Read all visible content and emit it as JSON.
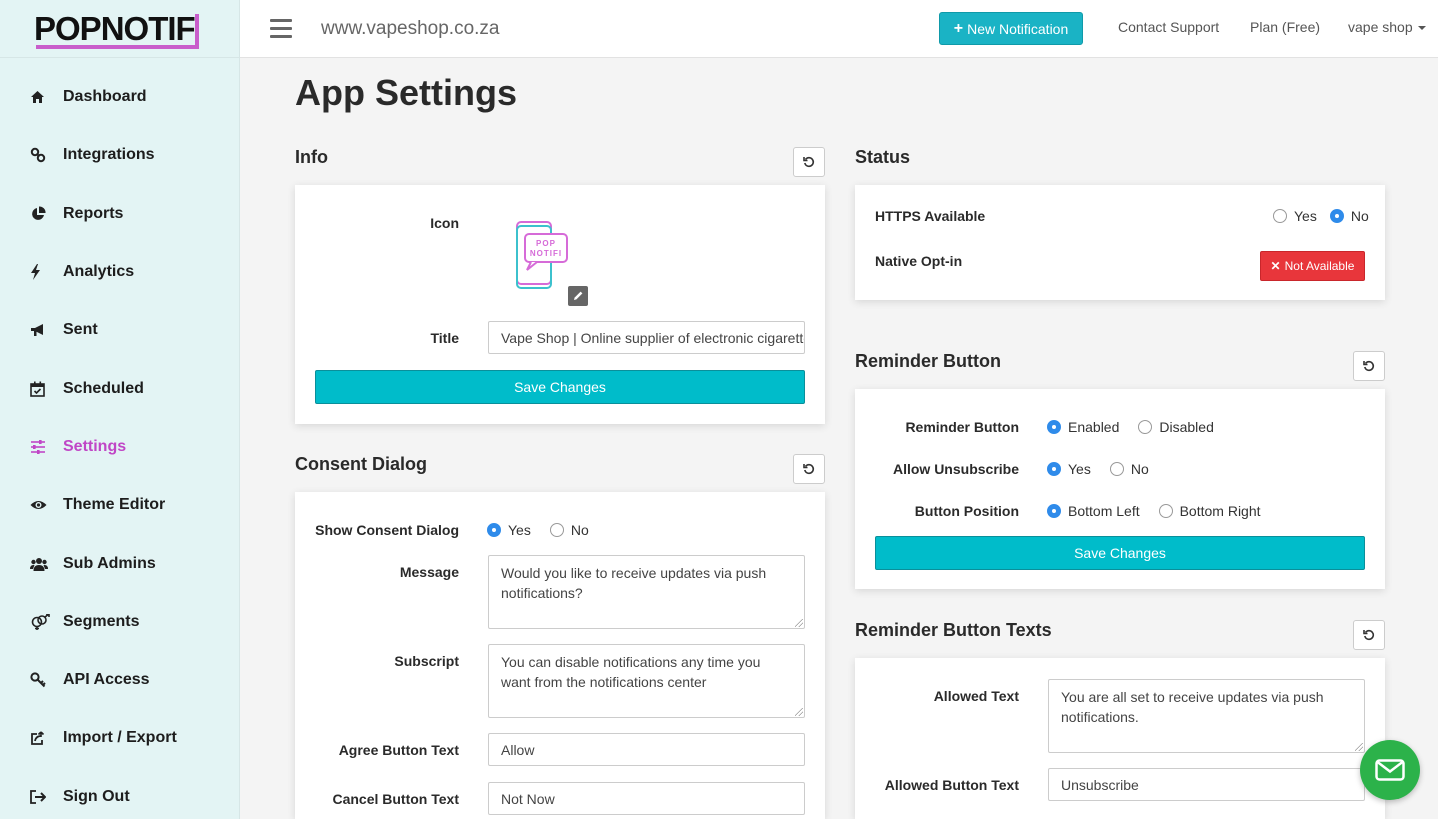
{
  "app": {
    "logo_text": "POPNOTIF"
  },
  "sidebar": {
    "items": [
      {
        "label": "Dashboard",
        "icon": "home-icon"
      },
      {
        "label": "Integrations",
        "icon": "link-icon"
      },
      {
        "label": "Reports",
        "icon": "pie-chart-icon"
      },
      {
        "label": "Analytics",
        "icon": "bolt-icon"
      },
      {
        "label": "Sent",
        "icon": "megaphone-icon"
      },
      {
        "label": "Scheduled",
        "icon": "calendar-check-icon"
      },
      {
        "label": "Settings",
        "icon": "sliders-icon"
      },
      {
        "label": "Theme Editor",
        "icon": "eye-icon"
      },
      {
        "label": "Sub Admins",
        "icon": "users-icon"
      },
      {
        "label": "Segments",
        "icon": "gender-icon"
      },
      {
        "label": "API Access",
        "icon": "key-icon"
      },
      {
        "label": "Import / Export",
        "icon": "share-icon"
      },
      {
        "label": "Sign Out",
        "icon": "sign-out-icon"
      }
    ],
    "active": "Settings"
  },
  "header": {
    "site_url": "www.vapeshop.co.za",
    "new_notification": "New Notification",
    "contact_support": "Contact Support",
    "plan": "Plan (Free)",
    "account": "vape shop"
  },
  "page": {
    "title": "App Settings"
  },
  "info": {
    "title": "Info",
    "icon_label": "Icon",
    "icon_text_top": "POP",
    "icon_text_bottom": "NOTIFI",
    "title_label": "Title",
    "title_value": "Vape Shop | Online supplier of electronic cigarettes",
    "save_label": "Save Changes"
  },
  "consent": {
    "title": "Consent Dialog",
    "show_label": "Show Consent Dialog",
    "show_yes": "Yes",
    "show_no": "No",
    "show_value": "Yes",
    "message_label": "Message",
    "message_value": "Would you like to receive updates via push notifications?",
    "subscript_label": "Subscript",
    "subscript_value": "You can disable notifications any time you want from the notifications center",
    "agree_label": "Agree Button Text",
    "agree_value": "Allow",
    "cancel_label": "Cancel Button Text",
    "cancel_value": "Not Now"
  },
  "status": {
    "title": "Status",
    "https_label": "HTTPS Available",
    "https_yes": "Yes",
    "https_no": "No",
    "https_value": "No",
    "native_label": "Native Opt-in",
    "native_badge": "Not Available"
  },
  "reminder": {
    "title": "Reminder Button",
    "button_label": "Reminder Button",
    "enabled": "Enabled",
    "disabled": "Disabled",
    "button_value": "Enabled",
    "unsub_label": "Allow Unsubscribe",
    "unsub_yes": "Yes",
    "unsub_no": "No",
    "unsub_value": "Yes",
    "position_label": "Button Position",
    "bottom_left": "Bottom Left",
    "bottom_right": "Bottom Right",
    "position_value": "Bottom Left",
    "save_label": "Save Changes"
  },
  "reminder_texts": {
    "title": "Reminder Button Texts",
    "allowed_text_label": "Allowed Text",
    "allowed_text_value": "You are all set to receive updates via push notifications.",
    "allowed_button_label": "Allowed Button Text",
    "allowed_button_value": "Unsubscribe"
  },
  "colors": {
    "accent": "#00bcca",
    "brand": "#c046c6",
    "danger": "#e8363b",
    "radio": "#2f8bea",
    "chat": "#2cb24a"
  }
}
